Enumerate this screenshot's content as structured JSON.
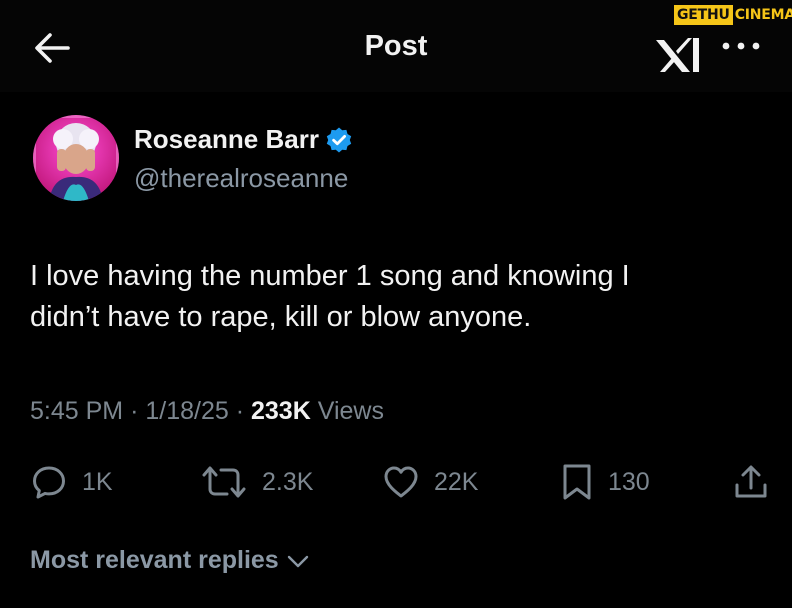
{
  "header": {
    "title": "Post"
  },
  "watermark": {
    "part1": "GETHU",
    "part2": "CINEMA"
  },
  "author": {
    "name": "Roseanne Barr",
    "handle": "@therealroseanne",
    "verified": true
  },
  "tweet": {
    "line1": "I love having the number 1 song and knowing I",
    "line2": "didn’t have to rape, kill or blow anyone."
  },
  "meta": {
    "time": "5:45 PM",
    "date": "1/18/25",
    "views_count": "233K",
    "views_label": "Views",
    "separator": "·"
  },
  "actions": {
    "replies": "1K",
    "reposts": "2.3K",
    "likes": "22K",
    "bookmarks": "130"
  },
  "replies_sort": {
    "label": "Most relevant replies"
  },
  "colors": {
    "background": "#000000",
    "verified": "#1d9bf0",
    "muted": "#8b98a5",
    "text": "#f2f2f2"
  }
}
